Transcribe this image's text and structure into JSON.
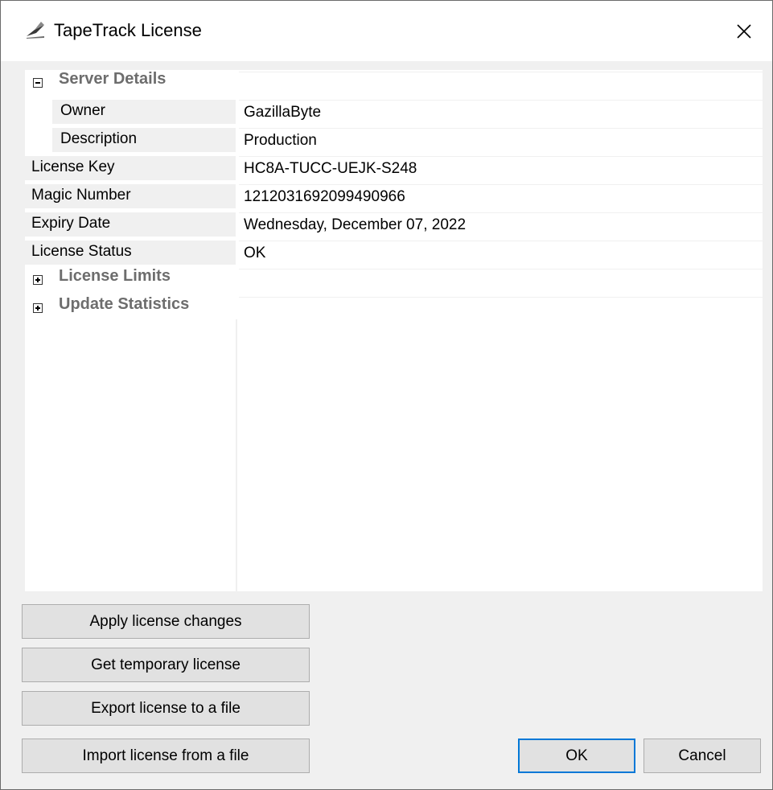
{
  "window": {
    "title": "TapeTrack License"
  },
  "grid": {
    "rows": [
      {
        "label": "Server Details",
        "value": "",
        "type": "category",
        "expander": "collapse"
      },
      {
        "label": "Owner",
        "value": "GazillaByte",
        "type": "child"
      },
      {
        "label": "Description",
        "value": "Production",
        "type": "child"
      },
      {
        "label": "License Key",
        "value": "HC8A-TUCC-UEJK-S248",
        "type": "property"
      },
      {
        "label": "Magic Number",
        "value": "1212031692099490966",
        "type": "property"
      },
      {
        "label": "Expiry Date",
        "value": "Wednesday, December 07, 2022",
        "type": "property"
      },
      {
        "label": "License Status",
        "value": "OK",
        "type": "property"
      },
      {
        "label": "License Limits",
        "value": "",
        "type": "category",
        "expander": "expand"
      },
      {
        "label": "Update Statistics",
        "value": "",
        "type": "category",
        "expander": "expand"
      }
    ]
  },
  "buttons": {
    "apply": "Apply license changes",
    "temporary": "Get temporary license",
    "export": "Export license to a file",
    "import": "Import license from a file",
    "ok": "OK",
    "cancel": "Cancel"
  },
  "icons": {
    "app": "tapetrack-app-icon",
    "close": "close-icon"
  },
  "colors": {
    "dialog_bg": "#f0f0f0",
    "category_text": "#6d6d6d",
    "default_button_border": "#0078d7"
  }
}
